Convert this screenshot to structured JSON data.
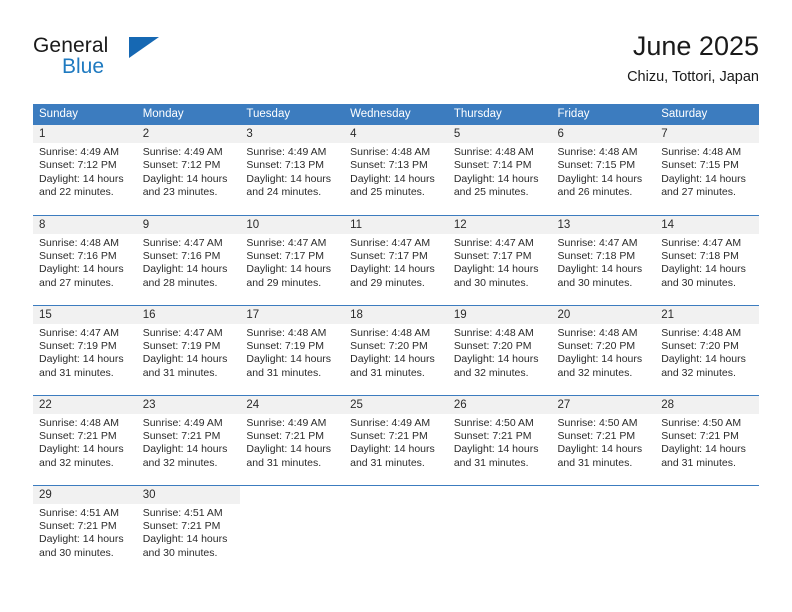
{
  "brand": {
    "name_top": "General",
    "name_bottom": "Blue",
    "accent_color": "#1668b3",
    "text_color": "#1a1a1a",
    "triangle_icon": "triangle-icon"
  },
  "header": {
    "title": "June 2025",
    "subtitle": "Chizu, Tottori, Japan"
  },
  "theme": {
    "header_row_bg": "#3c7cbf",
    "header_row_text": "#ffffff",
    "daynum_bg": "#f1f1f1",
    "grid_line": "#3c7cbf",
    "body_text": "#2b2b2b"
  },
  "weekdays": [
    "Sunday",
    "Monday",
    "Tuesday",
    "Wednesday",
    "Thursday",
    "Friday",
    "Saturday"
  ],
  "weeks": [
    [
      {
        "day": "1",
        "sunrise": "Sunrise: 4:49 AM",
        "sunset": "Sunset: 7:12 PM",
        "daylight": "Daylight: 14 hours and 22 minutes."
      },
      {
        "day": "2",
        "sunrise": "Sunrise: 4:49 AM",
        "sunset": "Sunset: 7:12 PM",
        "daylight": "Daylight: 14 hours and 23 minutes."
      },
      {
        "day": "3",
        "sunrise": "Sunrise: 4:49 AM",
        "sunset": "Sunset: 7:13 PM",
        "daylight": "Daylight: 14 hours and 24 minutes."
      },
      {
        "day": "4",
        "sunrise": "Sunrise: 4:48 AM",
        "sunset": "Sunset: 7:13 PM",
        "daylight": "Daylight: 14 hours and 25 minutes."
      },
      {
        "day": "5",
        "sunrise": "Sunrise: 4:48 AM",
        "sunset": "Sunset: 7:14 PM",
        "daylight": "Daylight: 14 hours and 25 minutes."
      },
      {
        "day": "6",
        "sunrise": "Sunrise: 4:48 AM",
        "sunset": "Sunset: 7:15 PM",
        "daylight": "Daylight: 14 hours and 26 minutes."
      },
      {
        "day": "7",
        "sunrise": "Sunrise: 4:48 AM",
        "sunset": "Sunset: 7:15 PM",
        "daylight": "Daylight: 14 hours and 27 minutes."
      }
    ],
    [
      {
        "day": "8",
        "sunrise": "Sunrise: 4:48 AM",
        "sunset": "Sunset: 7:16 PM",
        "daylight": "Daylight: 14 hours and 27 minutes."
      },
      {
        "day": "9",
        "sunrise": "Sunrise: 4:47 AM",
        "sunset": "Sunset: 7:16 PM",
        "daylight": "Daylight: 14 hours and 28 minutes."
      },
      {
        "day": "10",
        "sunrise": "Sunrise: 4:47 AM",
        "sunset": "Sunset: 7:17 PM",
        "daylight": "Daylight: 14 hours and 29 minutes."
      },
      {
        "day": "11",
        "sunrise": "Sunrise: 4:47 AM",
        "sunset": "Sunset: 7:17 PM",
        "daylight": "Daylight: 14 hours and 29 minutes."
      },
      {
        "day": "12",
        "sunrise": "Sunrise: 4:47 AM",
        "sunset": "Sunset: 7:17 PM",
        "daylight": "Daylight: 14 hours and 30 minutes."
      },
      {
        "day": "13",
        "sunrise": "Sunrise: 4:47 AM",
        "sunset": "Sunset: 7:18 PM",
        "daylight": "Daylight: 14 hours and 30 minutes."
      },
      {
        "day": "14",
        "sunrise": "Sunrise: 4:47 AM",
        "sunset": "Sunset: 7:18 PM",
        "daylight": "Daylight: 14 hours and 30 minutes."
      }
    ],
    [
      {
        "day": "15",
        "sunrise": "Sunrise: 4:47 AM",
        "sunset": "Sunset: 7:19 PM",
        "daylight": "Daylight: 14 hours and 31 minutes."
      },
      {
        "day": "16",
        "sunrise": "Sunrise: 4:47 AM",
        "sunset": "Sunset: 7:19 PM",
        "daylight": "Daylight: 14 hours and 31 minutes."
      },
      {
        "day": "17",
        "sunrise": "Sunrise: 4:48 AM",
        "sunset": "Sunset: 7:19 PM",
        "daylight": "Daylight: 14 hours and 31 minutes."
      },
      {
        "day": "18",
        "sunrise": "Sunrise: 4:48 AM",
        "sunset": "Sunset: 7:20 PM",
        "daylight": "Daylight: 14 hours and 31 minutes."
      },
      {
        "day": "19",
        "sunrise": "Sunrise: 4:48 AM",
        "sunset": "Sunset: 7:20 PM",
        "daylight": "Daylight: 14 hours and 32 minutes."
      },
      {
        "day": "20",
        "sunrise": "Sunrise: 4:48 AM",
        "sunset": "Sunset: 7:20 PM",
        "daylight": "Daylight: 14 hours and 32 minutes."
      },
      {
        "day": "21",
        "sunrise": "Sunrise: 4:48 AM",
        "sunset": "Sunset: 7:20 PM",
        "daylight": "Daylight: 14 hours and 32 minutes."
      }
    ],
    [
      {
        "day": "22",
        "sunrise": "Sunrise: 4:48 AM",
        "sunset": "Sunset: 7:21 PM",
        "daylight": "Daylight: 14 hours and 32 minutes."
      },
      {
        "day": "23",
        "sunrise": "Sunrise: 4:49 AM",
        "sunset": "Sunset: 7:21 PM",
        "daylight": "Daylight: 14 hours and 32 minutes."
      },
      {
        "day": "24",
        "sunrise": "Sunrise: 4:49 AM",
        "sunset": "Sunset: 7:21 PM",
        "daylight": "Daylight: 14 hours and 31 minutes."
      },
      {
        "day": "25",
        "sunrise": "Sunrise: 4:49 AM",
        "sunset": "Sunset: 7:21 PM",
        "daylight": "Daylight: 14 hours and 31 minutes."
      },
      {
        "day": "26",
        "sunrise": "Sunrise: 4:50 AM",
        "sunset": "Sunset: 7:21 PM",
        "daylight": "Daylight: 14 hours and 31 minutes."
      },
      {
        "day": "27",
        "sunrise": "Sunrise: 4:50 AM",
        "sunset": "Sunset: 7:21 PM",
        "daylight": "Daylight: 14 hours and 31 minutes."
      },
      {
        "day": "28",
        "sunrise": "Sunrise: 4:50 AM",
        "sunset": "Sunset: 7:21 PM",
        "daylight": "Daylight: 14 hours and 31 minutes."
      }
    ],
    [
      {
        "day": "29",
        "sunrise": "Sunrise: 4:51 AM",
        "sunset": "Sunset: 7:21 PM",
        "daylight": "Daylight: 14 hours and 30 minutes."
      },
      {
        "day": "30",
        "sunrise": "Sunrise: 4:51 AM",
        "sunset": "Sunset: 7:21 PM",
        "daylight": "Daylight: 14 hours and 30 minutes."
      },
      {
        "day": "",
        "sunrise": "",
        "sunset": "",
        "daylight": ""
      },
      {
        "day": "",
        "sunrise": "",
        "sunset": "",
        "daylight": ""
      },
      {
        "day": "",
        "sunrise": "",
        "sunset": "",
        "daylight": ""
      },
      {
        "day": "",
        "sunrise": "",
        "sunset": "",
        "daylight": ""
      },
      {
        "day": "",
        "sunrise": "",
        "sunset": "",
        "daylight": ""
      }
    ]
  ]
}
